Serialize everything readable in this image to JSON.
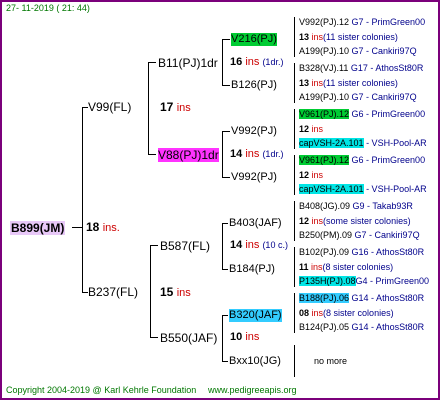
{
  "header": {
    "timestamp": "27- 11-2019 ( 21: 44)"
  },
  "footer": {
    "copyright": "Copyright 2004-2019 @ Karl Kehrle Foundation",
    "site": "www.pedigreeapis.org"
  },
  "root": {
    "name": "B899(JM)",
    "ins": "18",
    "ins_label": "ins."
  },
  "gen1": {
    "top": {
      "name": "V99(FL)",
      "ins": "17",
      "ins_label": "ins"
    },
    "bottom": {
      "name": "B237(FL)",
      "ins": "15",
      "ins_label": "ins"
    }
  },
  "gen2": {
    "a": {
      "name": "B11(PJ)1dr",
      "ins": "16",
      "ins_label": "ins",
      "note": "(1dr.)"
    },
    "b": {
      "name": "V88(PJ)1dr",
      "ins": "14",
      "ins_label": "ins",
      "note": "(1dr.)"
    },
    "c": {
      "name": "B587(FL)",
      "ins": "14",
      "ins_label": "ins",
      "note": "(10 c.)"
    },
    "d": {
      "name": "B550(JAF)",
      "ins": "10",
      "ins_label": "ins"
    }
  },
  "gen3": {
    "a1": "V216(PJ)",
    "a2": "B126(PJ)",
    "b1": "V992(PJ)",
    "b2": "V992(PJ)",
    "c1": "B403(JAF)",
    "c2": "B184(PJ)",
    "d1": "B320(JAF)",
    "d2": "Bxx10(JG)"
  },
  "gen4": [
    {
      "top": "V992(PJ).12",
      "top_src": "G7 - PrimGreen00",
      "mid_num": "13",
      "mid_ins": "ins",
      "mid_note": "(11 sister colonies)",
      "bot": "A199(PJ).10",
      "bot_src": "G7 - Cankiri97Q"
    },
    {
      "top": "B328(VJ).11",
      "top_src": "G17 - AthosSt80R",
      "mid_num": "13",
      "mid_ins": "ins",
      "mid_note": "(11 sister colonies)",
      "bot": "A199(PJ).10",
      "bot_src": "G7 - Cankiri97Q"
    },
    {
      "top": "V961(PJ).12",
      "top_src": "G6 - PrimGreen00",
      "mid_num": "12",
      "mid_ins": "ins",
      "mid_note": "",
      "bot": "capVSH-2A.101",
      "bot_src": "- VSH-Pool-AR"
    },
    {
      "top": "V961(PJ).12",
      "top_src": "G6 - PrimGreen00",
      "mid_num": "12",
      "mid_ins": "ins",
      "mid_note": "",
      "bot": "capVSH-2A.101",
      "bot_src": "- VSH-Pool-AR"
    },
    {
      "top": "B408(JG).09",
      "top_src": "G9 - Takab93R",
      "mid_num": "12",
      "mid_ins": "ins",
      "mid_note": "(some sister colonies)",
      "bot": "B250(PM).09",
      "bot_src": "G7 - Cankiri97Q"
    },
    {
      "top": "B102(PJ).09",
      "top_src": "G16 - AthosSt80R",
      "mid_num": "11",
      "mid_ins": "ins",
      "mid_note": "(8 sister colonies)",
      "bot": "P135H(PJ).08",
      "bot_src": "G4 - PrimGreen00"
    },
    {
      "top": "B188(PJ).06",
      "top_src": "G14 - AthosSt80R",
      "mid_num": "08",
      "mid_ins": "ins",
      "mid_note": "(8 sister colonies)",
      "bot": "B124(PJ).05",
      "bot_src": "G14 - AthosSt80R"
    }
  ],
  "nomore": "no more"
}
